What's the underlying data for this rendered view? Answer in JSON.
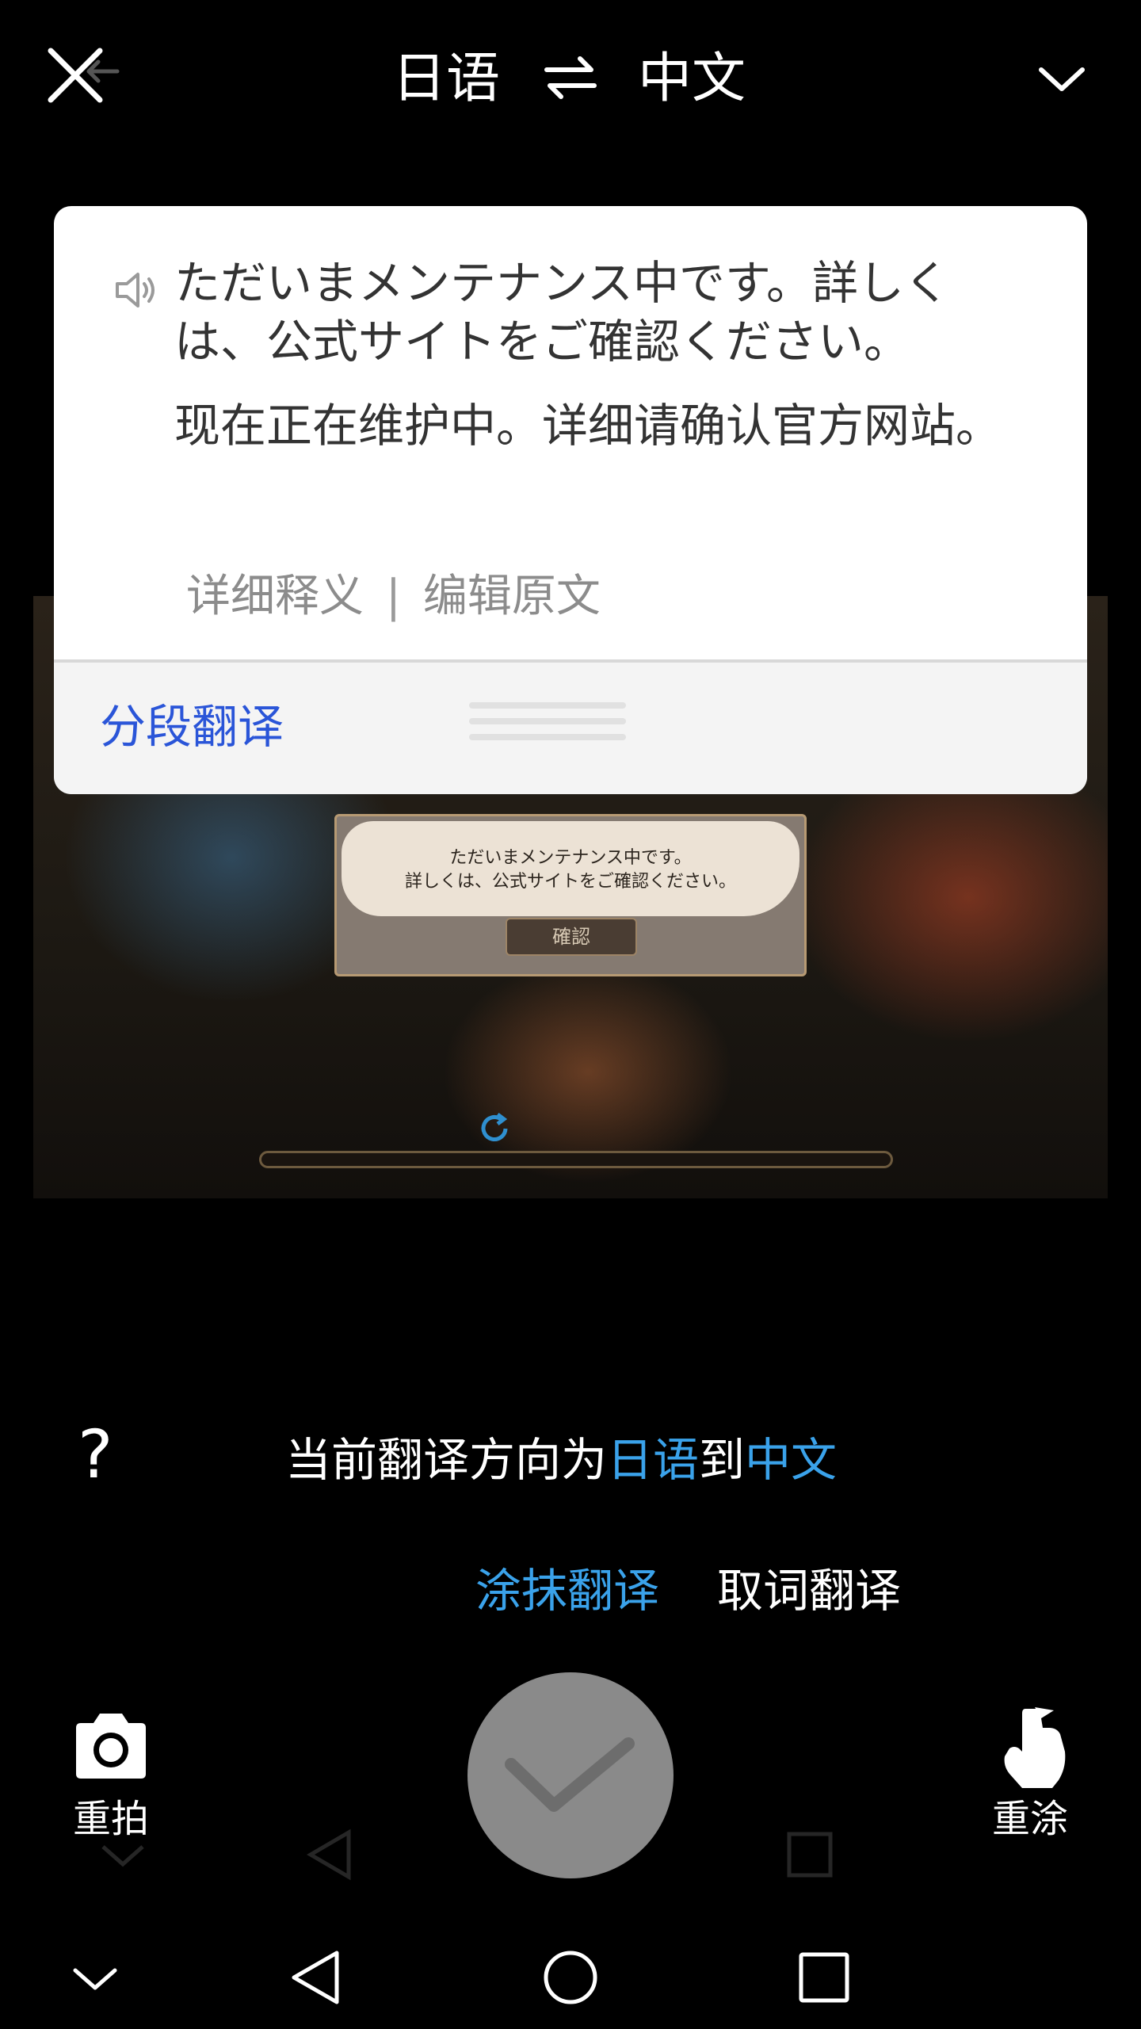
{
  "header": {
    "source_lang": "日语",
    "target_lang": "中文",
    "close_icon": "close-icon",
    "swap_icon": "swap-icon",
    "collapse_icon": "chevron-down-icon"
  },
  "card": {
    "source_text": "ただいまメンテナンス中です。詳しくは、公式サイトをご確認ください。",
    "translation_text": "现在正在维护中。详细请确认官方网站。",
    "detail_label": "详细释义",
    "separator": "|",
    "edit_label": "编辑原文",
    "segment_label": "分段翻译"
  },
  "game": {
    "dialog_line1": "ただいまメンテナンス中です。",
    "dialog_line2": "詳しくは、公式サイトをご確認ください。",
    "confirm_label": "確認"
  },
  "direction": {
    "prefix": "当前翻译方向为",
    "from": "日语",
    "middle": "到",
    "to": "中文"
  },
  "help_label": "?",
  "modes": {
    "smear": "涂抹翻译",
    "word": "取词翻译"
  },
  "bottom": {
    "retake_label": "重拍",
    "repaint_label": "重涂"
  },
  "colors": {
    "accent": "#3aa2ea",
    "segment_blue": "#2a55d8",
    "background": "#000000",
    "card": "#ffffff"
  }
}
